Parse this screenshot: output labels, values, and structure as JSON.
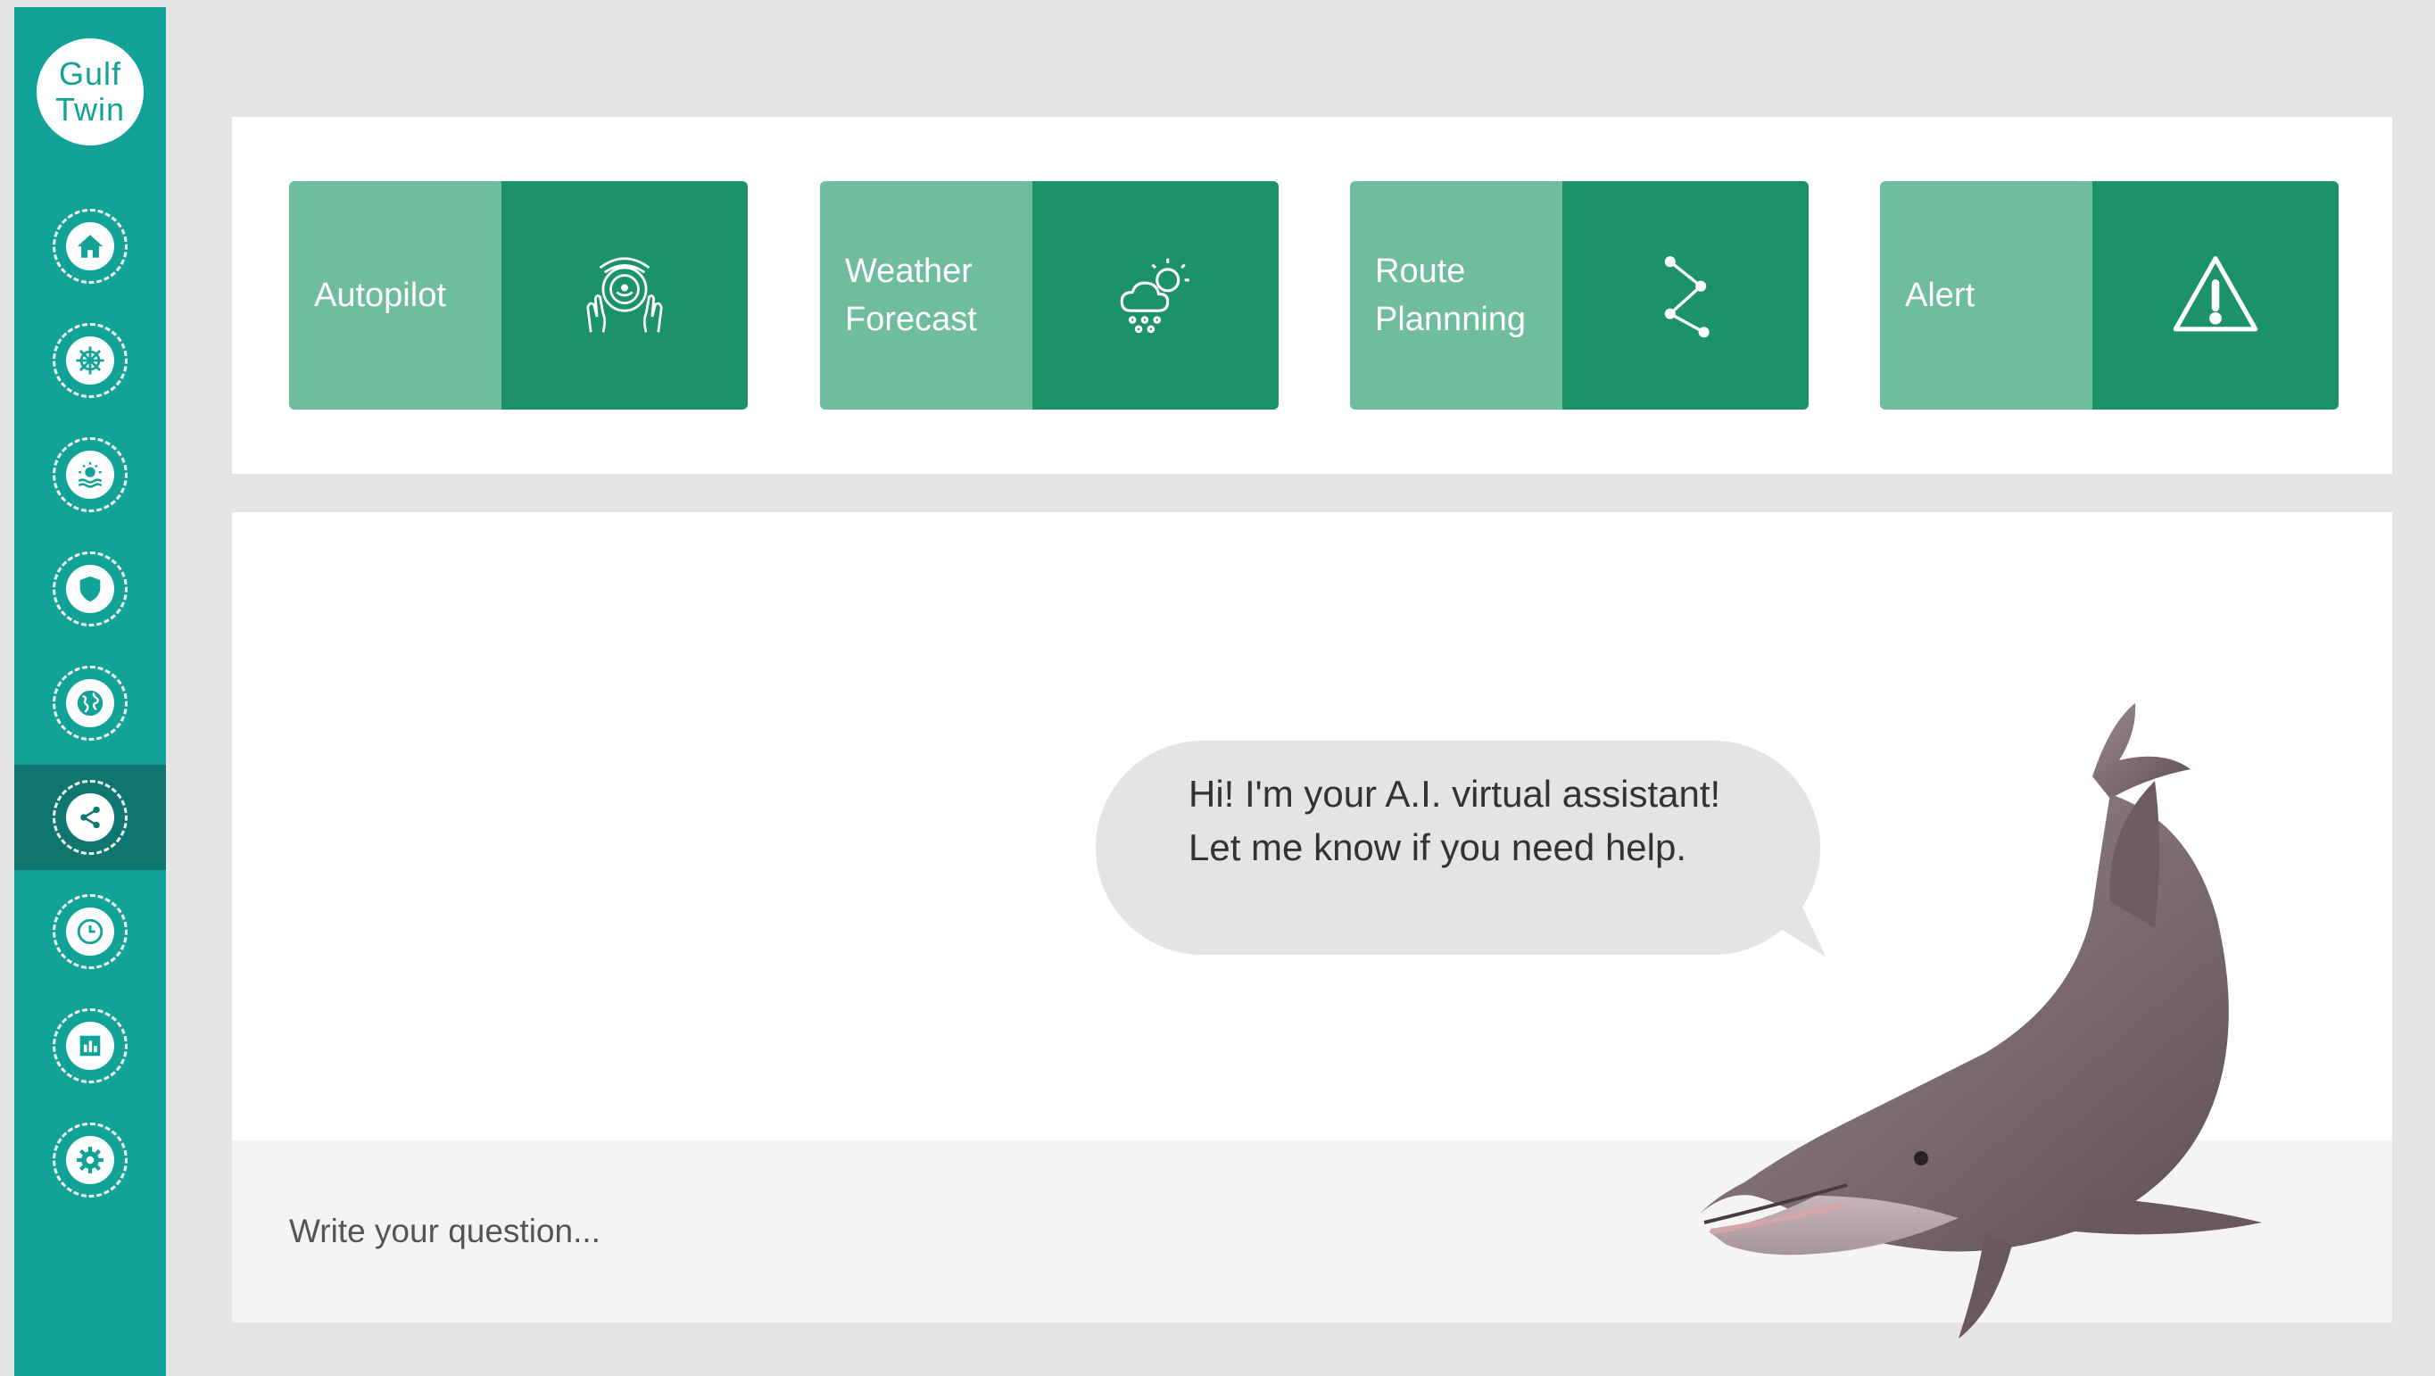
{
  "app": {
    "logo_text": "Gulf\nTwin"
  },
  "sidebar": {
    "items": [
      {
        "icon": "home-icon",
        "active": false
      },
      {
        "icon": "ship-wheel-icon",
        "active": false
      },
      {
        "icon": "sun-sea-icon",
        "active": false
      },
      {
        "icon": "shield-icon",
        "active": false
      },
      {
        "icon": "globe-icon",
        "active": false
      },
      {
        "icon": "share-icon",
        "active": true
      },
      {
        "icon": "clock-icon",
        "active": false
      },
      {
        "icon": "bar-chart-icon",
        "active": false
      },
      {
        "icon": "settings-icon",
        "active": false
      }
    ]
  },
  "cards": [
    {
      "label": "Autopilot",
      "icon": "steering-hands-icon"
    },
    {
      "label": "Weather\nForecast",
      "icon": "weather-icon"
    },
    {
      "label": "Route\nPlannning",
      "icon": "route-icon"
    },
    {
      "label": "Alert",
      "icon": "alert-triangle-icon"
    }
  ],
  "colors": {
    "sidebar": "#12a298",
    "sidebar_active": "#0f776f",
    "card_label": "#6fbc9f",
    "card_icon": "#1b9268"
  },
  "chat": {
    "assistant_message": "Hi! I'm your A.I. virtual assistant! Let me know if you need help.",
    "input_placeholder": "Write your question..."
  }
}
